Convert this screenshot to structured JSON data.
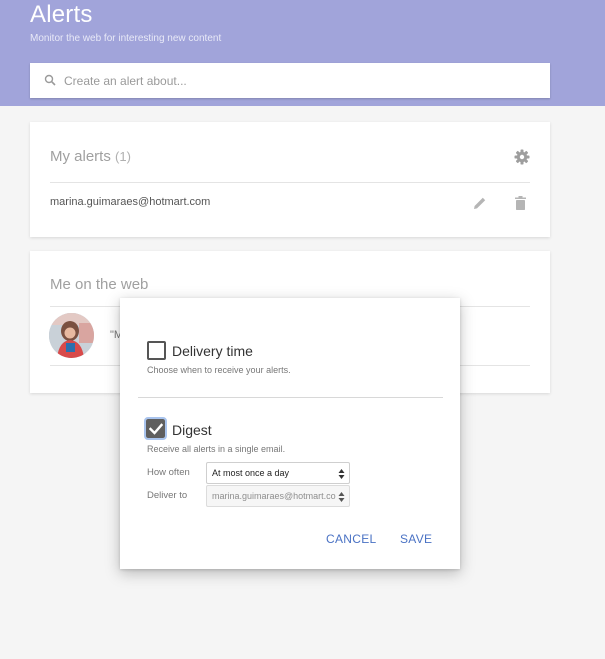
{
  "header": {
    "title": "Alerts",
    "subtitle": "Monitor the web for interesting new content",
    "search_placeholder": "Create an alert about..."
  },
  "my_alerts": {
    "title": "My alerts",
    "count": "(1)",
    "items": [
      {
        "email": "marina.guimaraes@hotmart.com"
      }
    ]
  },
  "me_on_web": {
    "title": "Me on the web",
    "snippet": "\"M"
  },
  "dialog": {
    "delivery_time": {
      "label": "Delivery time",
      "description": "Choose when to receive your alerts.",
      "checked": false
    },
    "digest": {
      "label": "Digest",
      "description": "Receive all alerts in a single email.",
      "checked": true
    },
    "how_often_label": "How often",
    "how_often_value": "At most once a day",
    "deliver_to_label": "Deliver to",
    "deliver_to_value": "marina.guimaraes@hotmart.co",
    "cancel_label": "CANCEL",
    "save_label": "SAVE"
  },
  "colors": {
    "header_bg": "#a1a4da",
    "accent": "#4a72c4"
  },
  "icons": [
    "search-icon",
    "gear-icon",
    "edit-icon",
    "delete-icon",
    "check-icon",
    "select-arrows-icon"
  ]
}
